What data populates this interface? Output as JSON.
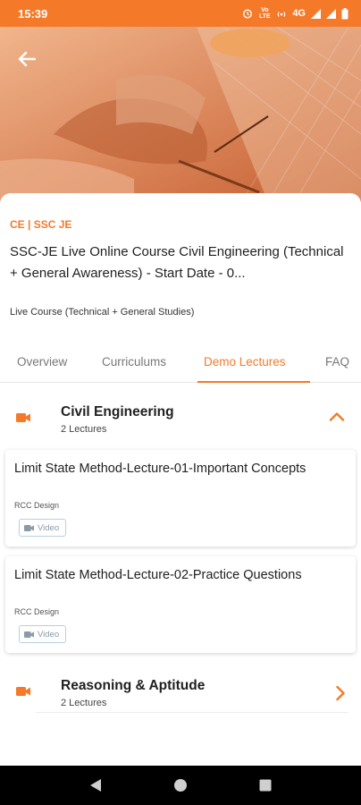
{
  "status_bar": {
    "time": "15:39",
    "volte_label": "Vo LTE",
    "network_label": "4G",
    "icons": [
      "alarm-icon",
      "volte-icon",
      "hotspot-icon",
      "network-4g-icon",
      "signal-icon",
      "signal-icon",
      "battery-icon"
    ]
  },
  "hero": {
    "back_icon": "arrow-left-icon"
  },
  "course": {
    "category": "CE | SSC JE",
    "title": "SSC-JE Live Online Course Civil Engineering (Technical + General Awareness) - Start Date - 0...",
    "type": "Live Course (Technical + General Studies)"
  },
  "tabs": [
    {
      "label": "Overview"
    },
    {
      "label": "Curriculums"
    },
    {
      "label": "Demo Lectures"
    },
    {
      "label": "FAQ"
    }
  ],
  "active_tab": "Demo Lectures",
  "sections": [
    {
      "title": "Civil Engineering",
      "count": "2 Lectures",
      "expanded": true,
      "lectures": [
        {
          "title": "Limit State Method-Lecture-01-Important Concepts",
          "subject": "RCC Design",
          "tag": "Video"
        },
        {
          "title": "Limit State Method-Lecture-02-Practice Questions",
          "subject": "RCC Design",
          "tag": "Video"
        }
      ]
    },
    {
      "title": "Reasoning & Aptitude",
      "count": "2 Lectures",
      "expanded": false
    }
  ],
  "colors": {
    "accent": "#f47a2a",
    "status_bar": "#f47a2a",
    "nav_bar": "#000000"
  },
  "nav_bar": {
    "buttons": [
      "back-triangle-icon",
      "home-circle-icon",
      "recents-square-icon"
    ]
  }
}
